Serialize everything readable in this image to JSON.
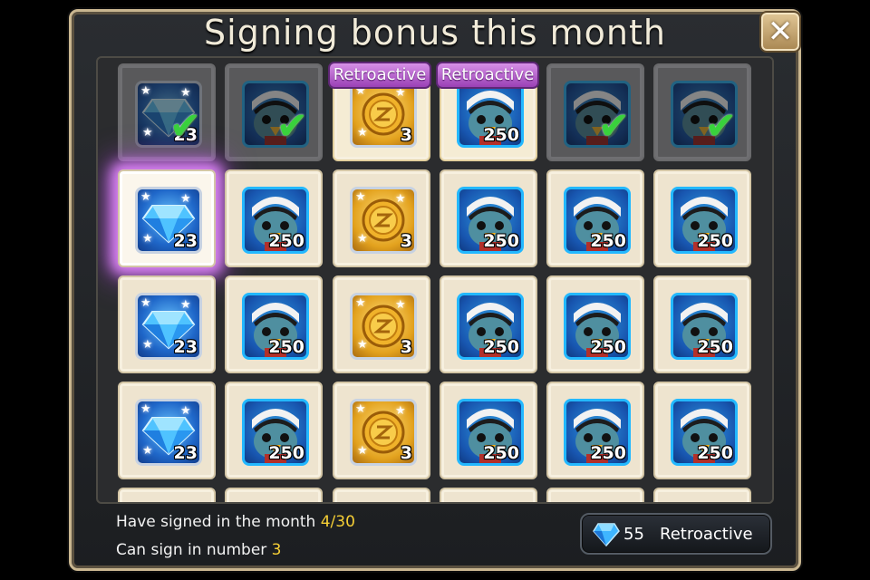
{
  "title": "Signing bonus this month",
  "close_label": "✕",
  "retro_tag": "Retroactive",
  "rows": [
    [
      {
        "type": "gem",
        "amount": "23",
        "state": "signed"
      },
      {
        "type": "bird",
        "amount": "",
        "state": "signed"
      },
      {
        "type": "coin",
        "amount": "3",
        "state": "retro"
      },
      {
        "type": "bird",
        "amount": "250",
        "state": "retro"
      },
      {
        "type": "bird",
        "amount": "",
        "state": "signed"
      },
      {
        "type": "bird",
        "amount": "",
        "state": "signed"
      }
    ],
    [
      {
        "type": "gem",
        "amount": "23",
        "state": "today"
      },
      {
        "type": "bird",
        "amount": "250",
        "state": "normal"
      },
      {
        "type": "coin",
        "amount": "3",
        "state": "normal"
      },
      {
        "type": "bird",
        "amount": "250",
        "state": "normal"
      },
      {
        "type": "bird",
        "amount": "250",
        "state": "normal"
      },
      {
        "type": "bird",
        "amount": "250",
        "state": "normal"
      }
    ],
    [
      {
        "type": "gem",
        "amount": "23",
        "state": "normal"
      },
      {
        "type": "bird",
        "amount": "250",
        "state": "normal"
      },
      {
        "type": "coin",
        "amount": "3",
        "state": "normal"
      },
      {
        "type": "bird",
        "amount": "250",
        "state": "normal"
      },
      {
        "type": "bird",
        "amount": "250",
        "state": "normal"
      },
      {
        "type": "bird",
        "amount": "250",
        "state": "normal"
      }
    ],
    [
      {
        "type": "gem",
        "amount": "23",
        "state": "normal"
      },
      {
        "type": "bird",
        "amount": "250",
        "state": "normal"
      },
      {
        "type": "coin",
        "amount": "3",
        "state": "normal"
      },
      {
        "type": "bird",
        "amount": "250",
        "state": "normal"
      },
      {
        "type": "bird",
        "amount": "250",
        "state": "normal"
      },
      {
        "type": "bird",
        "amount": "250",
        "state": "normal"
      }
    ]
  ],
  "footer": {
    "signed_label": "Have signed in the month",
    "signed_value": "4/30",
    "can_sign_label": "Can sign in number",
    "can_sign_value": "3"
  },
  "retro_button": {
    "cost": "55",
    "label": "Retroactive"
  },
  "colors": {
    "highlight": "#f6cf35",
    "retro_tag": "#b35ccc",
    "check": "#39d23c"
  }
}
